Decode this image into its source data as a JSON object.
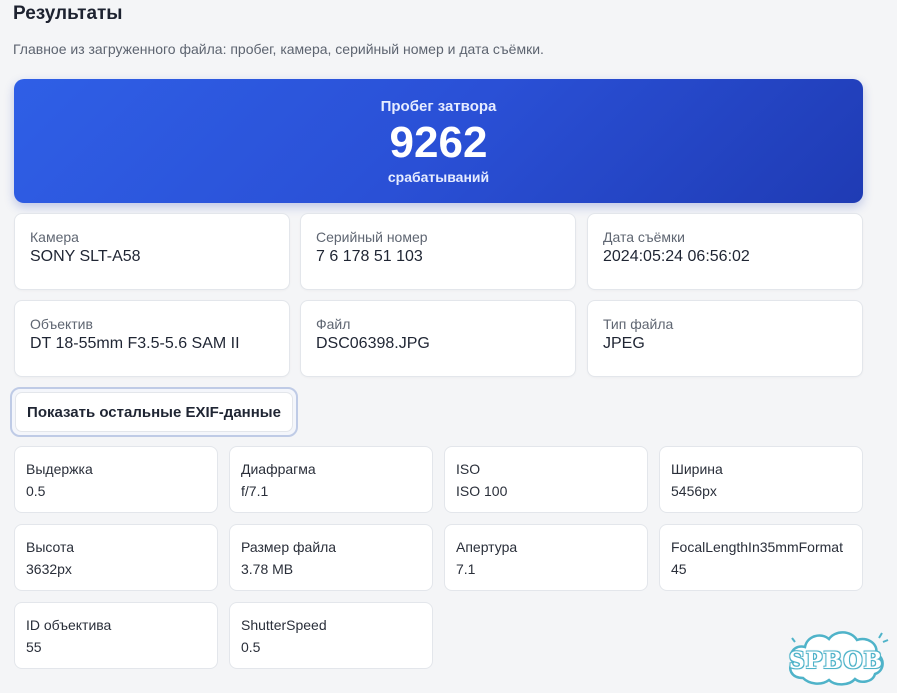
{
  "header": {
    "title": "Результаты",
    "subtitle": "Главное из загруженного файла: пробег, камера, серийный номер и дата съёмки."
  },
  "hero": {
    "label": "Пробег затвора",
    "value": "9262",
    "unit": "срабатываний"
  },
  "info_cards": [
    {
      "label": "Камера",
      "value": "SONY SLT-A58"
    },
    {
      "label": "Серийный номер",
      "value": "7 6 178 51 103"
    },
    {
      "label": "Дата съёмки",
      "value": "2024:05:24 06:56:02"
    },
    {
      "label": "Объектив",
      "value": "DT 18-55mm F3.5-5.6 SAM II"
    },
    {
      "label": "Файл",
      "value": "DSC06398.JPG"
    },
    {
      "label": "Тип файла",
      "value": "JPEG"
    }
  ],
  "exif_button": {
    "label": "Показать остальные EXIF-данные"
  },
  "exif_cards": [
    {
      "label": "Выдержка",
      "value": "0.5"
    },
    {
      "label": "Диафрагма",
      "value": "f/7.1"
    },
    {
      "label": "ISO",
      "value": "ISO 100"
    },
    {
      "label": "Ширина",
      "value": "5456px"
    },
    {
      "label": "Высота",
      "value": "3632px"
    },
    {
      "label": "Размер файла",
      "value": "3.78 MB"
    },
    {
      "label": "Апертура",
      "value": "7.1"
    },
    {
      "label": "FocalLengthIn35mmFormat",
      "value": "45"
    },
    {
      "label": "ID объектива",
      "value": "55"
    },
    {
      "label": "ShutterSpeed",
      "value": "0.5"
    }
  ],
  "watermark": {
    "text": "SPBOB"
  },
  "colors": {
    "accent_gradient_start": "#2f5fe6",
    "accent_gradient_end": "#1f3bb4",
    "background": "#f4f5f7",
    "card": "#ffffff",
    "watermark": "#4fb3c9"
  }
}
